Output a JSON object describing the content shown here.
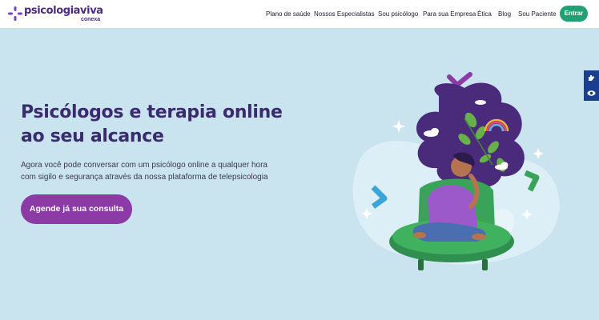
{
  "brand": {
    "name": "psicologiaviva",
    "sub": "conexa",
    "color": "#4b2a82"
  },
  "nav": {
    "items": [
      {
        "label": "Plano de saúde"
      },
      {
        "label": "Nossos Especialistas"
      },
      {
        "label": "Sou psicólogo"
      },
      {
        "label": "Para sua Empresa"
      },
      {
        "label": "Ética"
      },
      {
        "label": "Blog"
      },
      {
        "label": "Sou Paciente"
      }
    ],
    "login_label": "Entrar"
  },
  "hero": {
    "title_line1": "Psicólogos e terapia online",
    "title_line2": "ao seu alcance",
    "subtitle_line1": "Agora você pode conversar com um psicólogo online a qualquer hora",
    "subtitle_line2": "com sigilo e segurança através da nossa plataforma de telepsicologia",
    "cta_label": "Agende já sua consulta"
  },
  "accessibility": {
    "buttons": [
      {
        "icon": "sign-language-icon"
      },
      {
        "icon": "eye-icon"
      }
    ]
  },
  "colors": {
    "background": "#c9e3ef",
    "accent_green": "#1fa173",
    "cta_purple": "#8b3aa6",
    "title": "#3a2a6e"
  }
}
